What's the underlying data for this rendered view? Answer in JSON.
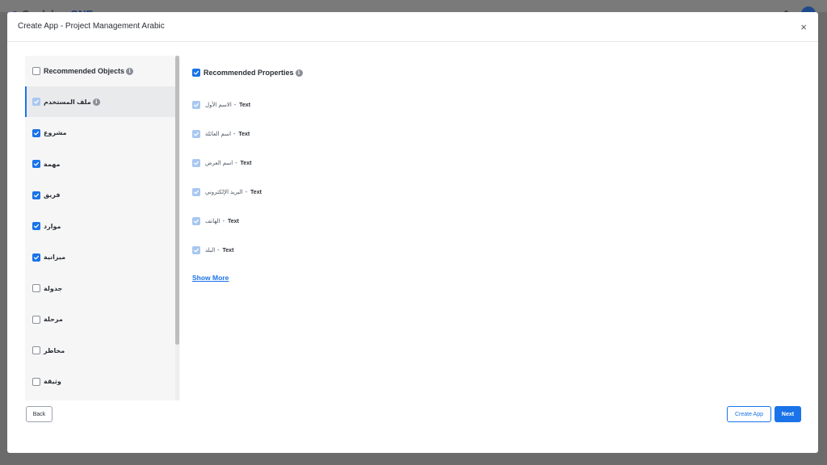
{
  "background": {
    "logo_text_left": "Coolaboo",
    "logo_text_brand": "ONE"
  },
  "modal": {
    "title": "Create App - Project Management Arabic",
    "close_symbol": "×"
  },
  "objects": {
    "header_label": "Recommended Objects",
    "items": [
      {
        "label": "ملف المستخدم",
        "state": "disabled",
        "selected": true,
        "info": true
      },
      {
        "label": "مشروع",
        "state": "checked"
      },
      {
        "label": "مهمة",
        "state": "checked"
      },
      {
        "label": "فريق",
        "state": "checked"
      },
      {
        "label": "موارد",
        "state": "checked"
      },
      {
        "label": "ميزانية",
        "state": "checked"
      },
      {
        "label": "جدولة",
        "state": "unchecked"
      },
      {
        "label": "مرحلة",
        "state": "unchecked"
      },
      {
        "label": "مخاطر",
        "state": "unchecked"
      },
      {
        "label": "وثيقة",
        "state": "unchecked"
      }
    ]
  },
  "properties": {
    "header_label": "Recommended Properties",
    "separator": "-",
    "items": [
      {
        "name": "الاسم الأول",
        "type": "Text"
      },
      {
        "name": "اسم العائلة",
        "type": "Text"
      },
      {
        "name": "اسم العرض",
        "type": "Text"
      },
      {
        "name": "البريد الإلكتروني",
        "type": "Text"
      },
      {
        "name": "الهاتف",
        "type": "Text"
      },
      {
        "name": "البلد",
        "type": "Text"
      }
    ],
    "show_more_label": "Show More"
  },
  "footer": {
    "back_label": "Back",
    "create_app_label": "Create App",
    "next_label": "Next"
  },
  "colors": {
    "accent": "#1a73e8",
    "checkbox_disabled": "#a8c7f0",
    "overlay": "#6b6b6b"
  }
}
